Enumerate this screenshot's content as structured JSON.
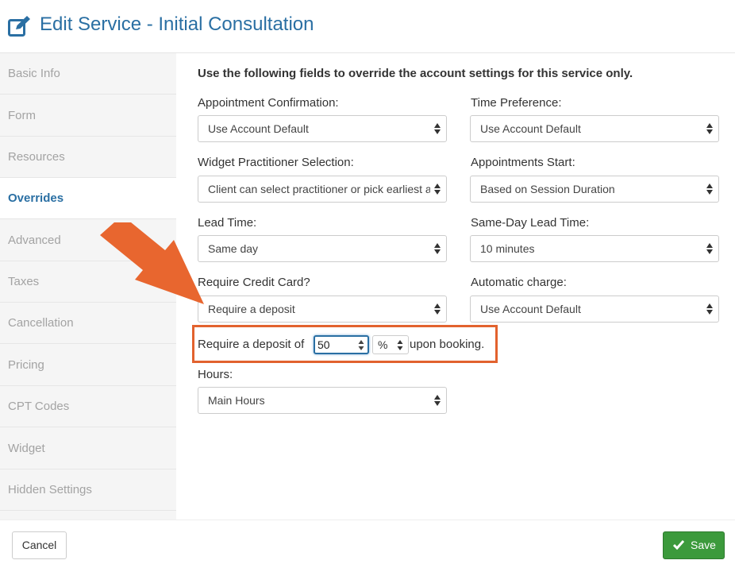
{
  "header": {
    "title": "Edit Service - Initial Consultation",
    "icon": "edit-icon"
  },
  "sidebar": {
    "items": [
      {
        "label": "Basic Info"
      },
      {
        "label": "Form"
      },
      {
        "label": "Resources"
      },
      {
        "label": "Overrides",
        "active": true
      },
      {
        "label": "Advanced"
      },
      {
        "label": "Taxes"
      },
      {
        "label": "Cancellation"
      },
      {
        "label": "Pricing"
      },
      {
        "label": "CPT Codes"
      },
      {
        "label": "Widget"
      },
      {
        "label": "Hidden Settings"
      }
    ]
  },
  "main": {
    "intro": "Use the following fields to override the account settings for this service only.",
    "fields": {
      "appointment_confirmation": {
        "label": "Appointment Confirmation:",
        "value": "Use Account Default"
      },
      "time_preference": {
        "label": "Time Preference:",
        "value": "Use Account Default"
      },
      "widget_practitioner_selection": {
        "label": "Widget Practitioner Selection:",
        "value": "Client can select practitioner or pick earliest a"
      },
      "appointments_start": {
        "label": "Appointments Start:",
        "value": "Based on Session Duration"
      },
      "lead_time": {
        "label": "Lead Time:",
        "value": "Same day"
      },
      "same_day_lead_time": {
        "label": "Same-Day Lead Time:",
        "value": "10 minutes"
      },
      "require_credit_card": {
        "label": "Require Credit Card?",
        "value": "Require a deposit"
      },
      "automatic_charge": {
        "label": "Automatic charge:",
        "value": "Use Account Default"
      },
      "hours": {
        "label": "Hours:",
        "value": "Main Hours"
      }
    },
    "deposit": {
      "prefix": "Require a deposit of",
      "amount": "50",
      "unit": "%",
      "suffix": "upon booking."
    }
  },
  "footer": {
    "cancel_label": "Cancel",
    "save_label": "Save"
  },
  "colors": {
    "accent": "#2a6fa3",
    "highlight": "#e2622e",
    "save_button": "#3c9a3c"
  }
}
